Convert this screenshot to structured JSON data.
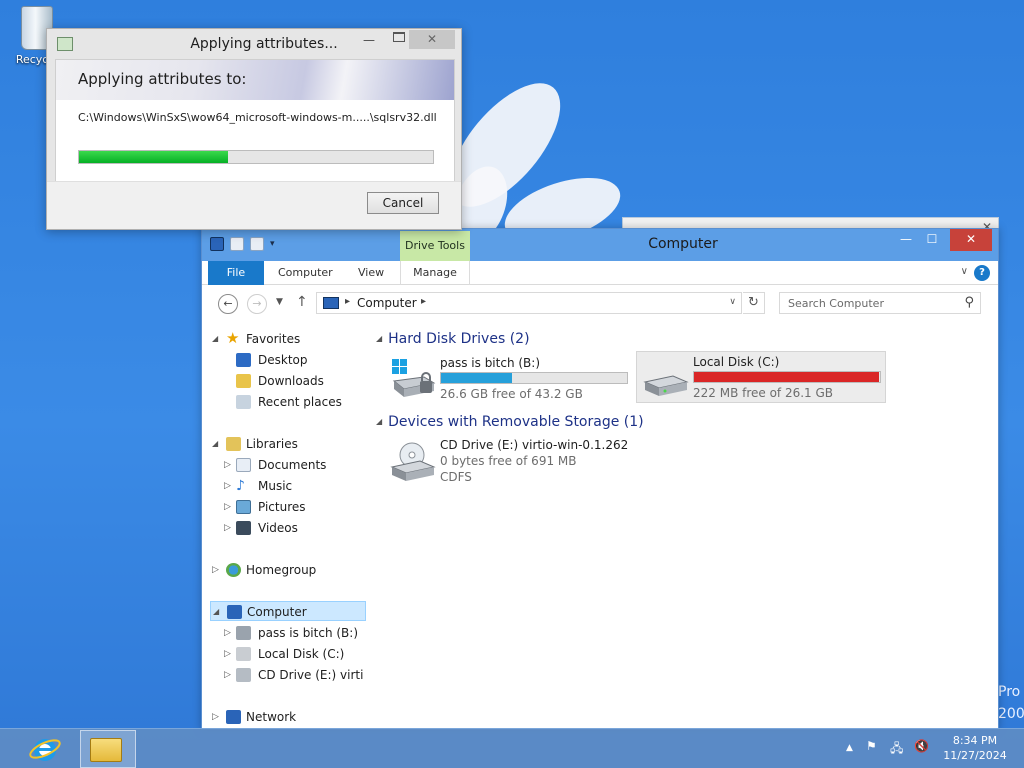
{
  "desktop": {
    "recycle_label": "Recycle",
    "edge_text_1": "Pro",
    "edge_text_2": "200"
  },
  "copy_dialog": {
    "title": "Applying attributes...",
    "header": "Applying attributes to:",
    "path": "C:\\Windows\\WinSxS\\wow64_microsoft-windows-m.....\\sqlsrv32.dll",
    "progress": 0.42,
    "cancel_label": "Cancel"
  },
  "explorer": {
    "title": "Computer",
    "context_tab": "Drive Tools",
    "ribbon_tabs": {
      "file": "File",
      "computer": "Computer",
      "view": "View",
      "manage": "Manage"
    },
    "address": {
      "crumb": "Computer"
    },
    "search": {
      "placeholder": "Search Computer"
    },
    "nav_tree": {
      "favorites": "Favorites",
      "desktop": "Desktop",
      "downloads": "Downloads",
      "recent_places": "Recent places",
      "libraries": "Libraries",
      "documents": "Documents",
      "music": "Music",
      "pictures": "Pictures",
      "videos": "Videos",
      "homegroup": "Homegroup",
      "computer": "Computer",
      "drive_b": "pass is bitch (B:)",
      "drive_c": "Local Disk (C:)",
      "drive_e": "CD Drive (E:) virtio-v",
      "network": "Network"
    },
    "groups": {
      "hard_disks": "Hard Disk Drives (2)",
      "removable": "Devices with Removable Storage (1)"
    },
    "drives": [
      {
        "name": "pass is bitch (B:)",
        "free": "26.6 GB free of 43.2 GB",
        "used_fraction": 0.384,
        "bar_color": "#26a0da"
      },
      {
        "name": "Local Disk (C:)",
        "free": "222 MB free of 26.1 GB",
        "used_fraction": 0.992,
        "bar_color": "#da2626"
      },
      {
        "name": "CD Drive (E:) virtio-win-0.1.262",
        "free": "0 bytes free of 691 MB",
        "fs": "CDFS"
      }
    ]
  },
  "taskbar": {
    "time": "8:34 PM",
    "date": "11/27/2024"
  }
}
